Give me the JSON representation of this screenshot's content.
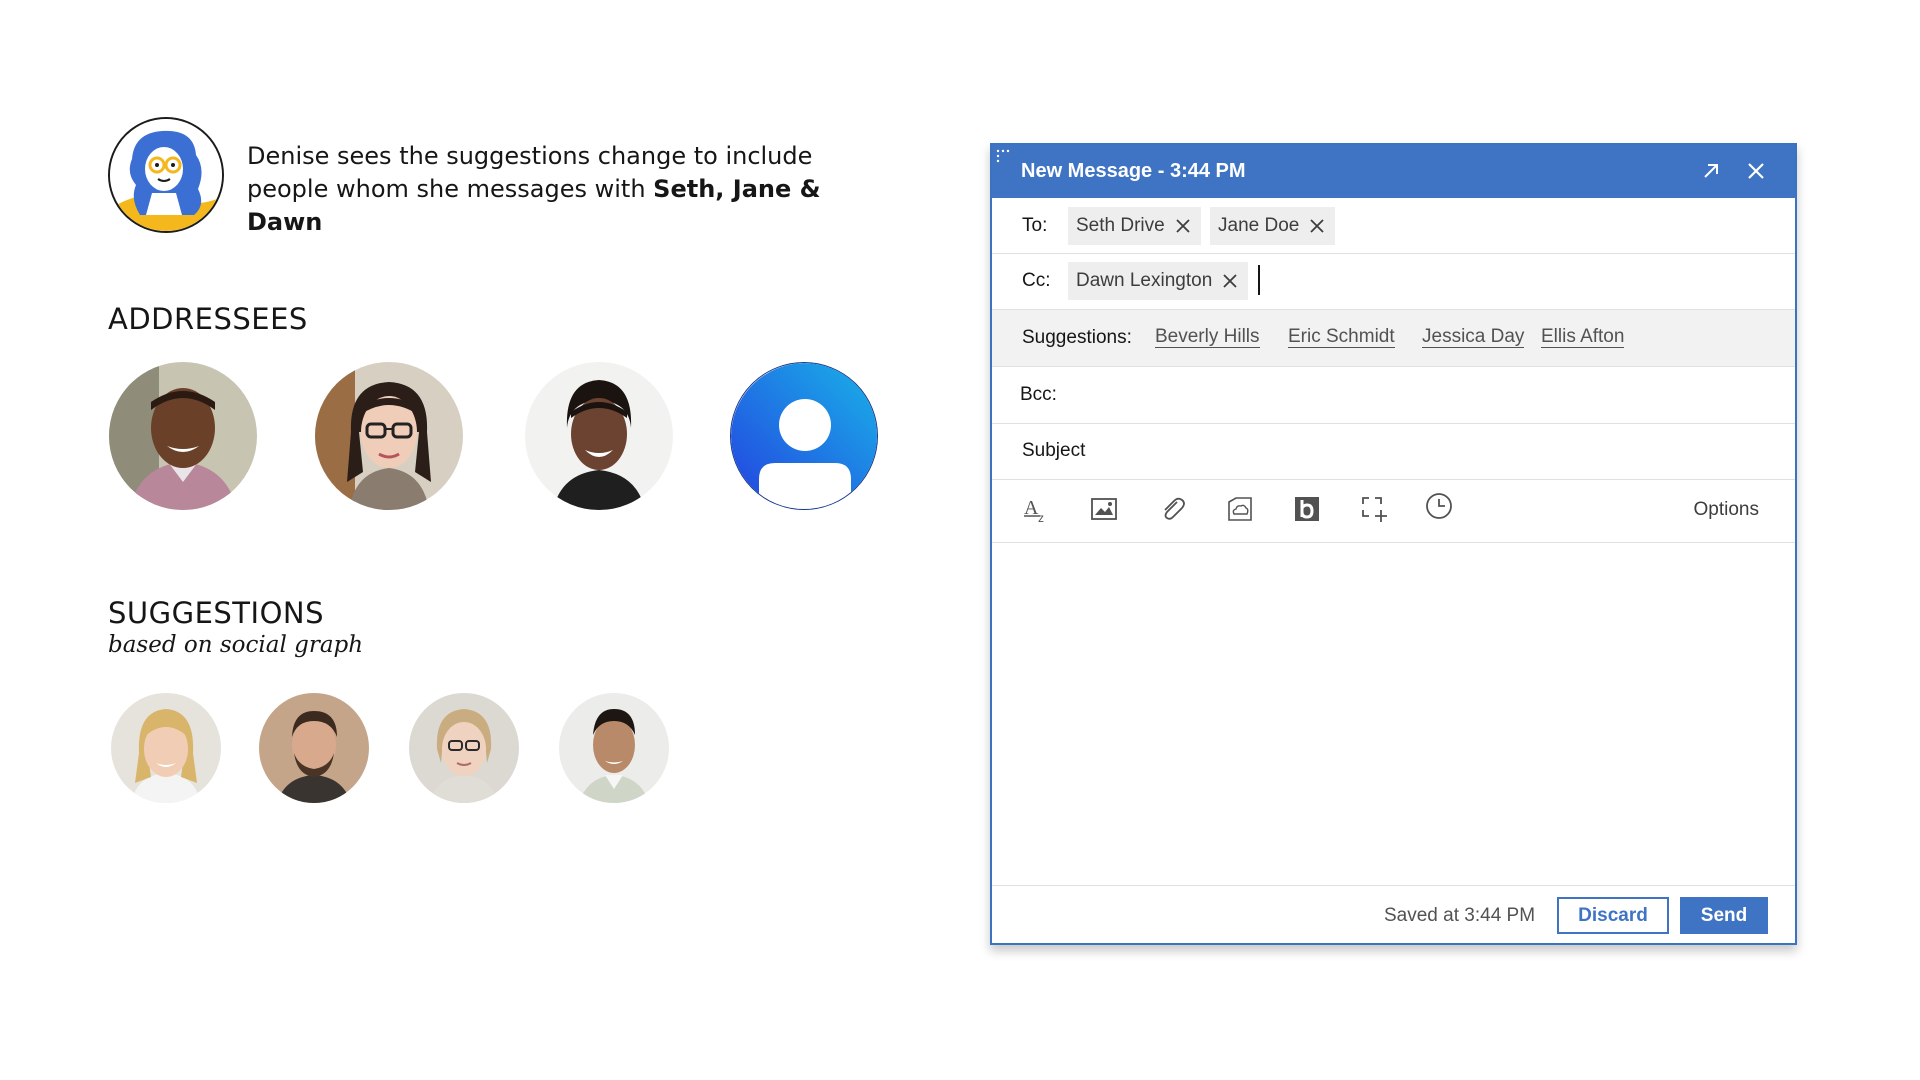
{
  "story": {
    "text": "Denise sees the suggestions change to include people whom she messages with ",
    "names": "Seth, Jane & Dawn"
  },
  "sections": {
    "addressees_title": "ADDRESSEES",
    "suggestions_title": "SUGGESTIONS",
    "suggestions_subtitle": "based on social graph"
  },
  "compose": {
    "title": "New Message - 3:44 PM",
    "to_label": "To:",
    "to_chips": [
      "Seth Drive",
      "Jane Doe"
    ],
    "cc_label": "Cc:",
    "cc_chips": [
      "Dawn Lexington"
    ],
    "suggestions_label": "Suggestions:",
    "suggestions": [
      "Beverly Hills",
      "Eric Schmidt",
      "Jessica Day",
      "Ellis Afton"
    ],
    "bcc_label": "Bcc:",
    "subject_placeholder": "Subject",
    "toolbar_icons": [
      "text-format-icon",
      "image-icon",
      "attachment-icon",
      "cloud-icon",
      "box-icon",
      "screenshot-icon",
      "clock-icon"
    ],
    "options_label": "Options",
    "saved_text": "Saved at 3:44 PM",
    "discard_label": "Discard",
    "send_label": "Send"
  },
  "colors": {
    "accent": "#3f74c4",
    "chip_bg": "#eeeeee",
    "suggestion_bar_bg": "#f2f2f2"
  }
}
